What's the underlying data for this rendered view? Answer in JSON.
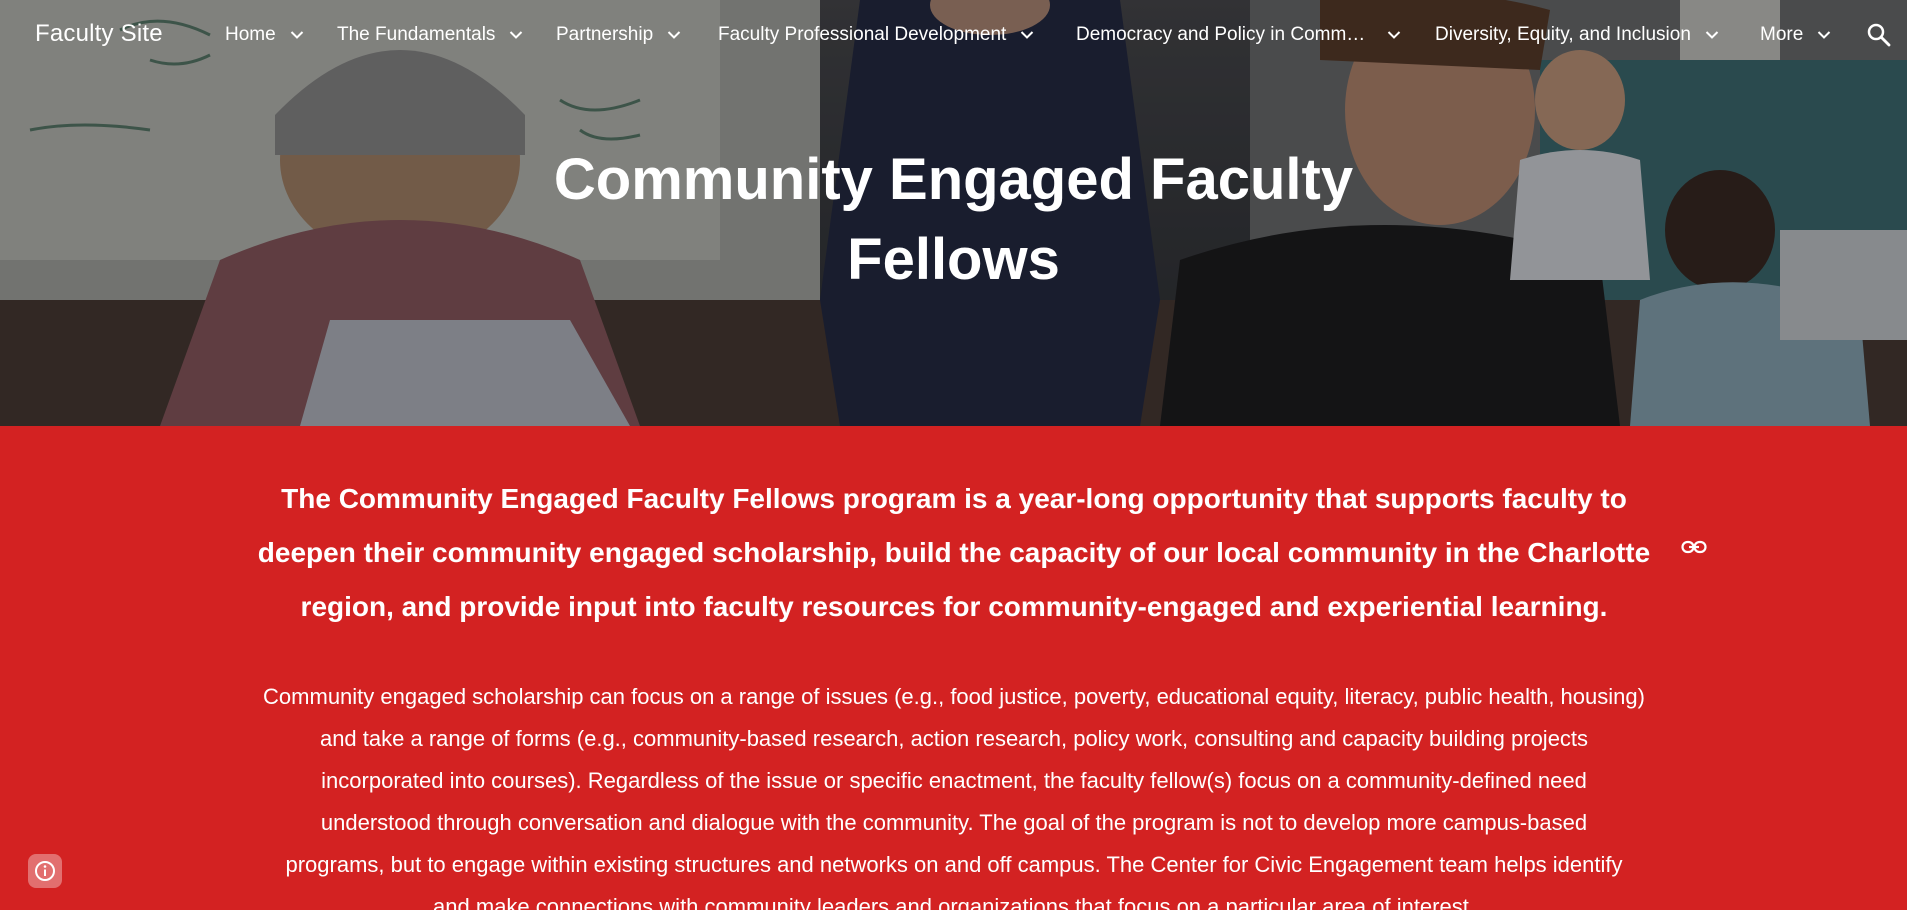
{
  "nav": {
    "site_title": "Faculty Site",
    "items": [
      {
        "label": "Home"
      },
      {
        "label": "The Fundamentals"
      },
      {
        "label": "Partnership"
      },
      {
        "label": "Faculty Professional Development"
      },
      {
        "label": "Democracy and Policy in Comm…"
      },
      {
        "label": "Diversity, Equity, and Inclusion"
      },
      {
        "label": "More"
      }
    ],
    "search_icon": "search-icon",
    "chevron_icon": "chevron-down-icon"
  },
  "hero": {
    "title_line1": "Community Engaged Faculty",
    "title_line2": "Fellows"
  },
  "lead": {
    "line1": "The Community Engaged Faculty Fellows program is a year-long opportunity that supports faculty to",
    "line2": "deepen their community engaged scholarship, build the capacity of our local community in the Charlotte",
    "line3": "region, and provide input into faculty resources for community-engaged and experiential learning.",
    "link_icon": "link-icon"
  },
  "body": {
    "lines": [
      "Community engaged scholarship can focus on a range of issues (e.g., food justice, poverty, educational equity, literacy, public health, housing)",
      "and take a range of forms (e.g., community-based research, action research, policy work, consulting and capacity building projects",
      "incorporated into courses).  Regardless of the issue or specific enactment, the faculty fellow(s) focus on a community-defined need",
      "understood through conversation and dialogue with the community.  The goal of the program is not to develop more campus-based",
      "programs, but to engage within existing structures and networks on and off campus. The Center for Civic Engagement team helps identify",
      "and make connections with community leaders and organizations that focus on a particular area of interest."
    ]
  },
  "footer": {
    "info_icon": "info-icon"
  },
  "colors": {
    "accent_red": "#d32222",
    "text_white": "#ffffff"
  }
}
